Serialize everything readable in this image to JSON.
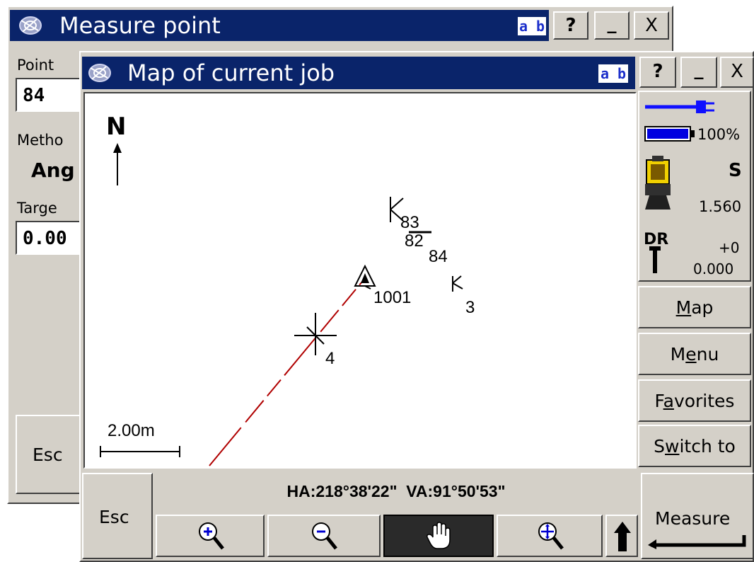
{
  "back_window": {
    "title": "Measure point",
    "ab_label": "a b",
    "help_label": "?",
    "minimize_label": "_",
    "close_label": "X",
    "point_label": "Point",
    "point_value": "84",
    "method_label": "Metho",
    "method_value": "Ang",
    "target_label": "Targe",
    "target_value": "0.00",
    "esc_label": "Esc"
  },
  "map_window": {
    "title": "Map of current job",
    "ab_label": "a b",
    "help_label": "?",
    "minimize_label": "_",
    "close_label": "X"
  },
  "map": {
    "north_label": "N",
    "scale_label": "2.00m",
    "points": [
      {
        "name": "83"
      },
      {
        "name": "82"
      },
      {
        "name": "84"
      },
      {
        "name": "1001"
      },
      {
        "name": "3"
      },
      {
        "name": "4"
      }
    ]
  },
  "status": {
    "battery_percent": "100%",
    "battery_level": 1.0,
    "instrument_face": "S",
    "target_height": "1.560",
    "dr_label": "DR",
    "prism_constant": "+0",
    "prism_offset": "0.000"
  },
  "side_buttons": {
    "map": {
      "pre": "",
      "ul": "M",
      "post": "ap"
    },
    "menu": {
      "pre": "M",
      "ul": "e",
      "post": "nu"
    },
    "favorites": {
      "pre": "F",
      "ul": "a",
      "post": "vorites"
    },
    "switch_to": {
      "pre": "S",
      "ul": "w",
      "post": "itch to"
    }
  },
  "bottom": {
    "esc_label": "Esc",
    "angles_text": "HA:218°38'22\"  VA:91°50'53\"",
    "measure_label": "Measure"
  },
  "icons": [
    "app-icon",
    "zoom-in-icon",
    "zoom-out-icon",
    "pan-hand-icon",
    "zoom-extents-icon",
    "up-arrow-icon",
    "power-plug-icon",
    "battery-icon",
    "total-station-icon",
    "prism-pole-icon"
  ]
}
